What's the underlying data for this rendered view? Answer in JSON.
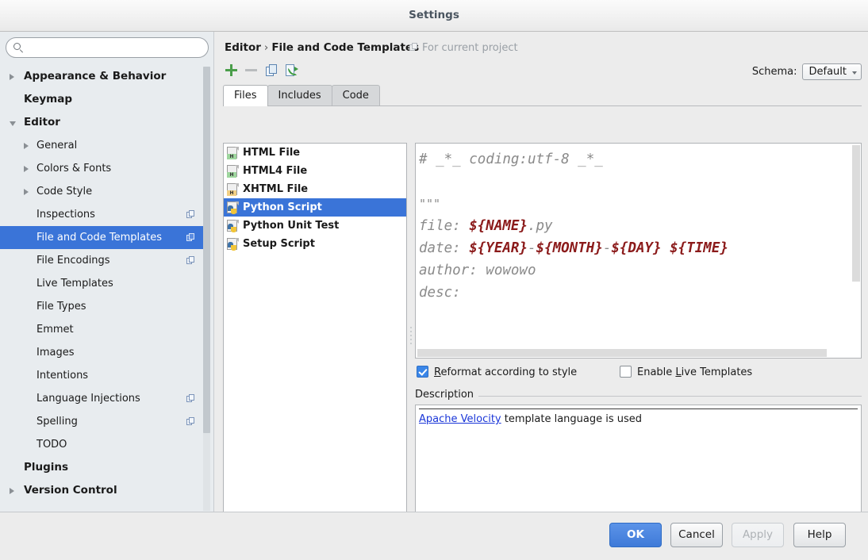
{
  "window": {
    "title": "Settings"
  },
  "search": {
    "value": "",
    "placeholder": "",
    "icon": "search-icon"
  },
  "sidebar": {
    "items": [
      {
        "label": "Appearance & Behavior",
        "level": 0,
        "arrow": "closed",
        "selected": false,
        "copy": false
      },
      {
        "label": "Keymap",
        "level": 0,
        "arrow": "none",
        "selected": false,
        "copy": false
      },
      {
        "label": "Editor",
        "level": 0,
        "arrow": "open",
        "selected": false,
        "copy": false
      },
      {
        "label": "General",
        "level": 1,
        "arrow": "closed",
        "selected": false,
        "copy": false
      },
      {
        "label": "Colors & Fonts",
        "level": 1,
        "arrow": "closed",
        "selected": false,
        "copy": false
      },
      {
        "label": "Code Style",
        "level": 1,
        "arrow": "closed",
        "selected": false,
        "copy": false
      },
      {
        "label": "Inspections",
        "level": 1,
        "arrow": "none",
        "selected": false,
        "copy": true
      },
      {
        "label": "File and Code Templates",
        "level": 1,
        "arrow": "none",
        "selected": true,
        "copy": true
      },
      {
        "label": "File Encodings",
        "level": 1,
        "arrow": "none",
        "selected": false,
        "copy": true
      },
      {
        "label": "Live Templates",
        "level": 1,
        "arrow": "none",
        "selected": false,
        "copy": false
      },
      {
        "label": "File Types",
        "level": 1,
        "arrow": "none",
        "selected": false,
        "copy": false
      },
      {
        "label": "Emmet",
        "level": 1,
        "arrow": "none",
        "selected": false,
        "copy": false
      },
      {
        "label": "Images",
        "level": 1,
        "arrow": "none",
        "selected": false,
        "copy": false
      },
      {
        "label": "Intentions",
        "level": 1,
        "arrow": "none",
        "selected": false,
        "copy": false
      },
      {
        "label": "Language Injections",
        "level": 1,
        "arrow": "none",
        "selected": false,
        "copy": true
      },
      {
        "label": "Spelling",
        "level": 1,
        "arrow": "none",
        "selected": false,
        "copy": true
      },
      {
        "label": "TODO",
        "level": 1,
        "arrow": "none",
        "selected": false,
        "copy": false
      },
      {
        "label": "Plugins",
        "level": 0,
        "arrow": "none",
        "selected": false,
        "copy": false
      },
      {
        "label": "Version Control",
        "level": 0,
        "arrow": "closed",
        "selected": false,
        "copy": false
      }
    ]
  },
  "header": {
    "breadcrumb_root": "Editor",
    "breadcrumb_sep": "›",
    "breadcrumb_leaf": "File and Code Templates",
    "scope_note": "For current project",
    "scope_icon": "project-scope-icon"
  },
  "toolbar": {
    "buttons": [
      {
        "name": "add-template-button",
        "icon": "plus-icon",
        "enabled": true
      },
      {
        "name": "remove-template-button",
        "icon": "minus-icon",
        "enabled": false
      },
      {
        "name": "copy-template-button",
        "icon": "copy-icon",
        "enabled": true
      },
      {
        "name": "reset-template-button",
        "icon": "reset-icon",
        "enabled": true
      }
    ]
  },
  "schema": {
    "label": "Schema:",
    "value": "Default"
  },
  "tabs": [
    {
      "label": "Files",
      "active": true
    },
    {
      "label": "Includes",
      "active": false
    },
    {
      "label": "Code",
      "active": false
    }
  ],
  "file_list": [
    {
      "label": "HTML File",
      "icon": "html-file-icon",
      "badge": "H",
      "badge_color": "green",
      "selected": false
    },
    {
      "label": "HTML4 File",
      "icon": "html4-file-icon",
      "badge": "H",
      "badge_color": "green",
      "selected": false
    },
    {
      "label": "XHTML File",
      "icon": "xhtml-file-icon",
      "badge": "H",
      "badge_color": "orange",
      "selected": false
    },
    {
      "label": "Python Script",
      "icon": "python-file-icon",
      "badge": "",
      "badge_color": "python",
      "selected": true
    },
    {
      "label": "Python Unit Test",
      "icon": "python-file-icon",
      "badge": "",
      "badge_color": "python",
      "selected": false
    },
    {
      "label": "Setup Script",
      "icon": "python-file-icon",
      "badge": "",
      "badge_color": "python",
      "selected": false
    }
  ],
  "editor": {
    "lines": [
      [
        {
          "t": "# _*_ coding:utf-8 _*_",
          "v": false
        }
      ],
      [
        {
          "t": "",
          "v": false
        }
      ],
      [
        {
          "t": "\"\"\"",
          "v": false
        }
      ],
      [
        {
          "t": "file: ",
          "v": false
        },
        {
          "t": "${NAME}",
          "v": true
        },
        {
          "t": ".py",
          "v": false
        }
      ],
      [
        {
          "t": "date: ",
          "v": false
        },
        {
          "t": "${YEAR}",
          "v": true
        },
        {
          "t": "-",
          "v": false
        },
        {
          "t": "${MONTH}",
          "v": true
        },
        {
          "t": "-",
          "v": false
        },
        {
          "t": "${DAY}",
          "v": true
        },
        {
          "t": " ",
          "v": false
        },
        {
          "t": "${TIME}",
          "v": true
        }
      ],
      [
        {
          "t": "author: wowowo",
          "v": false
        }
      ],
      [
        {
          "t": "desc:",
          "v": false
        }
      ]
    ]
  },
  "options": {
    "reformat": {
      "label_pre": "",
      "mnemonic": "R",
      "label_post": "eformat according to style",
      "checked": true
    },
    "live_templates": {
      "label_pre": "Enable ",
      "mnemonic": "L",
      "label_post": "ive Templates",
      "checked": false
    }
  },
  "description": {
    "legend": "Description",
    "link_text": "Apache Velocity",
    "rest_text": " template language is used"
  },
  "footer": {
    "buttons": [
      {
        "label": "OK",
        "style": "primary",
        "name": "ok-button"
      },
      {
        "label": "Cancel",
        "style": "normal",
        "name": "cancel-button"
      },
      {
        "label": "Apply",
        "style": "disabled",
        "name": "apply-button"
      },
      {
        "label": "Help",
        "style": "normal",
        "name": "help-button"
      }
    ]
  },
  "colors": {
    "selection_blue": "#3a74d8",
    "variable_red": "#8b1a1a",
    "link_blue": "#1a36d8",
    "accent_green": "#4a9e4a"
  }
}
